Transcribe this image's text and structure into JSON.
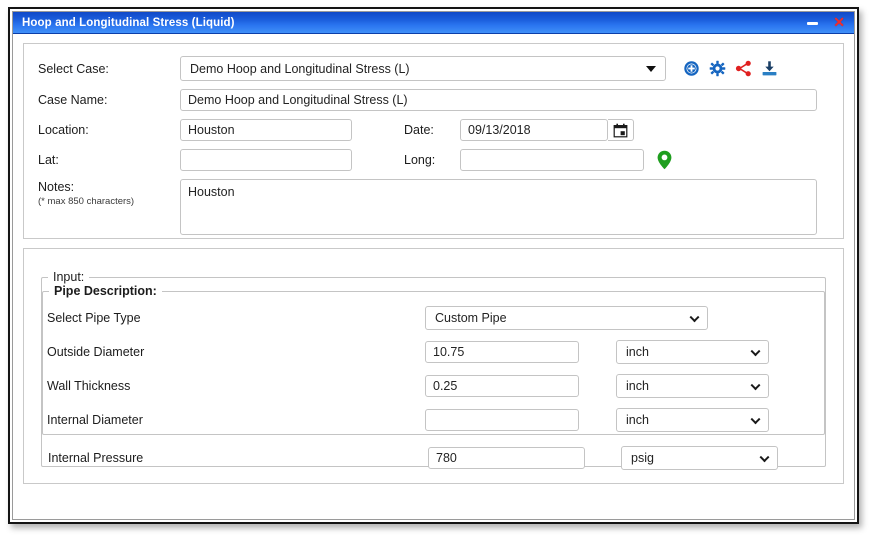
{
  "window": {
    "title": "Hoop and Longitudinal Stress (Liquid)",
    "minimize_label": "–",
    "close_label": "✕",
    "titlebar_color": "#1c5fdd",
    "close_color": "#f42b2b"
  },
  "case_section": {
    "select_case_label": "Select Case:",
    "select_case_value": "Demo Hoop and Longitudinal Stress (L)",
    "case_name_label": "Case Name:",
    "case_name_value": "Demo Hoop and Longitudinal Stress (L)",
    "location_label": "Location:",
    "location_value": "Houston",
    "date_label": "Date:",
    "date_value": "09/13/2018",
    "lat_label": "Lat:",
    "lat_value": "",
    "long_label": "Long:",
    "long_value": "",
    "notes_label": "Notes:",
    "notes_hint": "(* max 850 characters)",
    "notes_value": "Houston",
    "icons": [
      {
        "name": "add-case-icon",
        "title": "Add",
        "color": "#1565c0"
      },
      {
        "name": "settings-gear-icon",
        "title": "Settings",
        "color": "#1565c0"
      },
      {
        "name": "share-icon",
        "title": "Share",
        "color": "#e02020"
      },
      {
        "name": "download-icon",
        "title": "Download",
        "color": "#1565c0"
      }
    ],
    "calendar_icon": "calendar-icon",
    "map_pin_icon": "map-pin-icon",
    "map_pin_color": "#1f9e1f"
  },
  "input_section": {
    "legend": "Input:",
    "pipe_description": {
      "legend": "Pipe Description:",
      "fields": [
        {
          "label": "Select Pipe Type",
          "type": "select",
          "value": "Custom Pipe",
          "unit": null
        },
        {
          "label": "Outside Diameter",
          "type": "text",
          "value": "10.75",
          "unit": "inch"
        },
        {
          "label": "Wall Thickness",
          "type": "text",
          "value": "0.25",
          "unit": "inch"
        },
        {
          "label": "Internal Diameter",
          "type": "text",
          "value": "",
          "unit": "inch"
        }
      ]
    },
    "internal_pressure": {
      "label": "Internal Pressure",
      "value": "780",
      "unit": "psig"
    }
  }
}
